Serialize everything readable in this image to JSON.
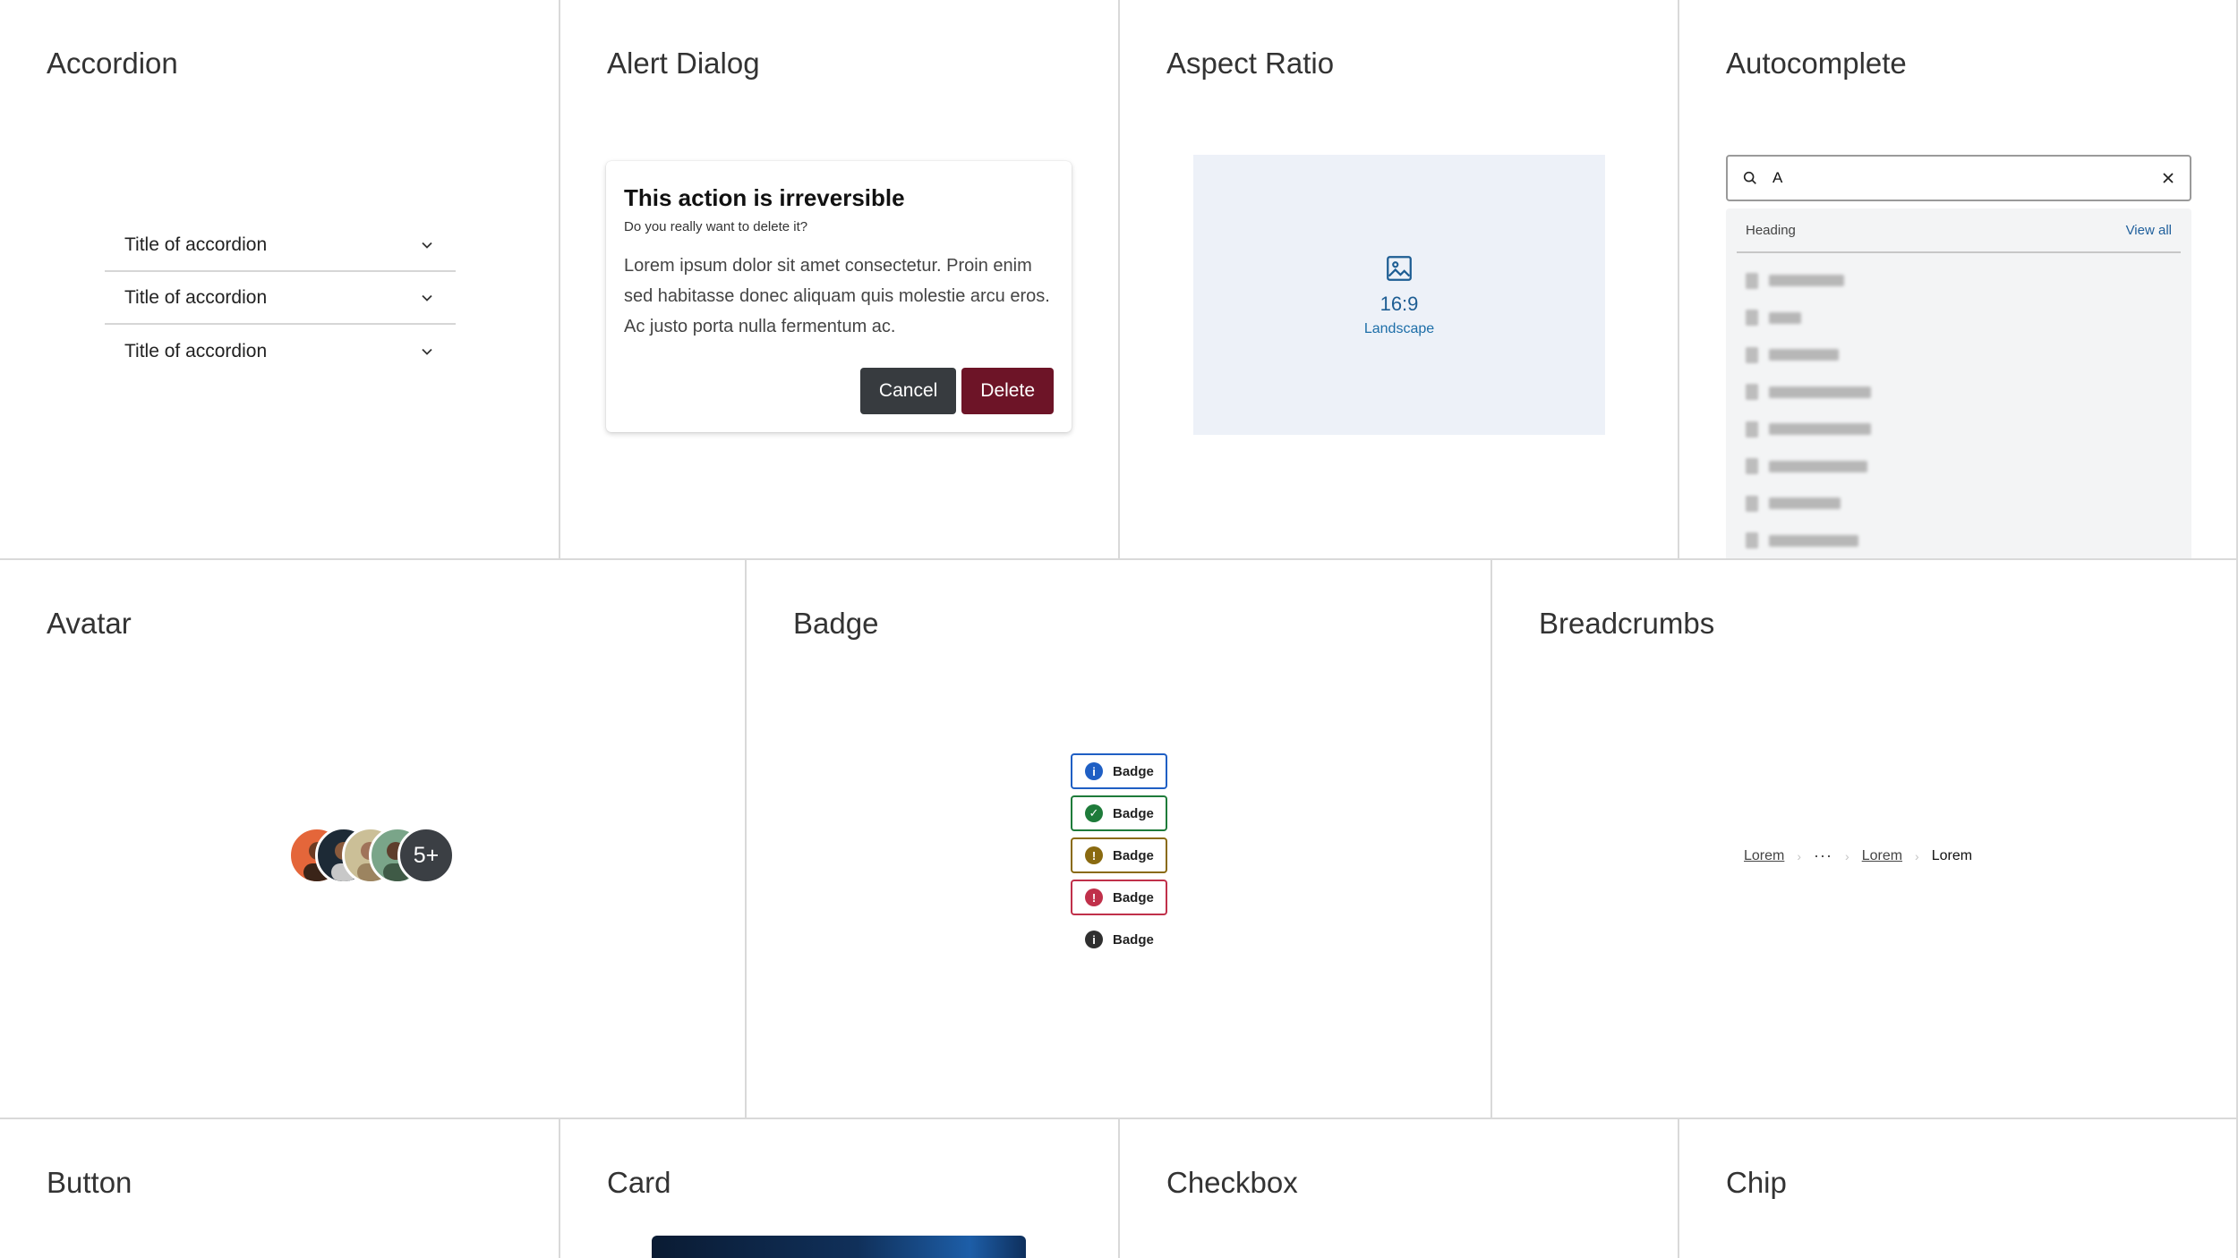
{
  "accordion": {
    "title": "Accordion",
    "items": [
      "Title of accordion",
      "Title of accordion",
      "Title of accordion"
    ]
  },
  "alert_dialog": {
    "title": "Alert Dialog",
    "dialog_heading": "This action is irreversible",
    "dialog_subheading": "Do you really want to delete it?",
    "dialog_body": "Lorem ipsum dolor sit amet consectetur. Proin enim sed habitasse donec aliquam quis molestie arcu eros. Ac justo porta nulla fermentum ac.",
    "cancel_label": "Cancel",
    "delete_label": "Delete"
  },
  "aspect_ratio": {
    "title": "Aspect Ratio",
    "ratio": "16:9",
    "orientation": "Landscape"
  },
  "autocomplete": {
    "title": "Autocomplete",
    "query": "A",
    "panel_heading": "Heading",
    "view_all": "View all"
  },
  "avatar": {
    "title": "Avatar",
    "overflow_count": "5+"
  },
  "badge": {
    "title": "Badge",
    "items": [
      {
        "label": "Badge",
        "status": "info",
        "color": "#1f5fc4"
      },
      {
        "label": "Badge",
        "status": "success",
        "color": "#1e7b3a"
      },
      {
        "label": "Badge",
        "status": "warning",
        "color": "#8a6a10"
      },
      {
        "label": "Badge",
        "status": "error",
        "color": "#c0304a"
      },
      {
        "label": "Badge",
        "status": "neutral",
        "color": "#2f2f2f"
      }
    ]
  },
  "breadcrumbs": {
    "title": "Breadcrumbs",
    "items": [
      "Lorem",
      "···",
      "Lorem",
      "Lorem"
    ]
  },
  "button": {
    "title": "Button"
  },
  "card": {
    "title": "Card"
  },
  "checkbox": {
    "title": "Checkbox"
  },
  "chip": {
    "title": "Chip"
  }
}
